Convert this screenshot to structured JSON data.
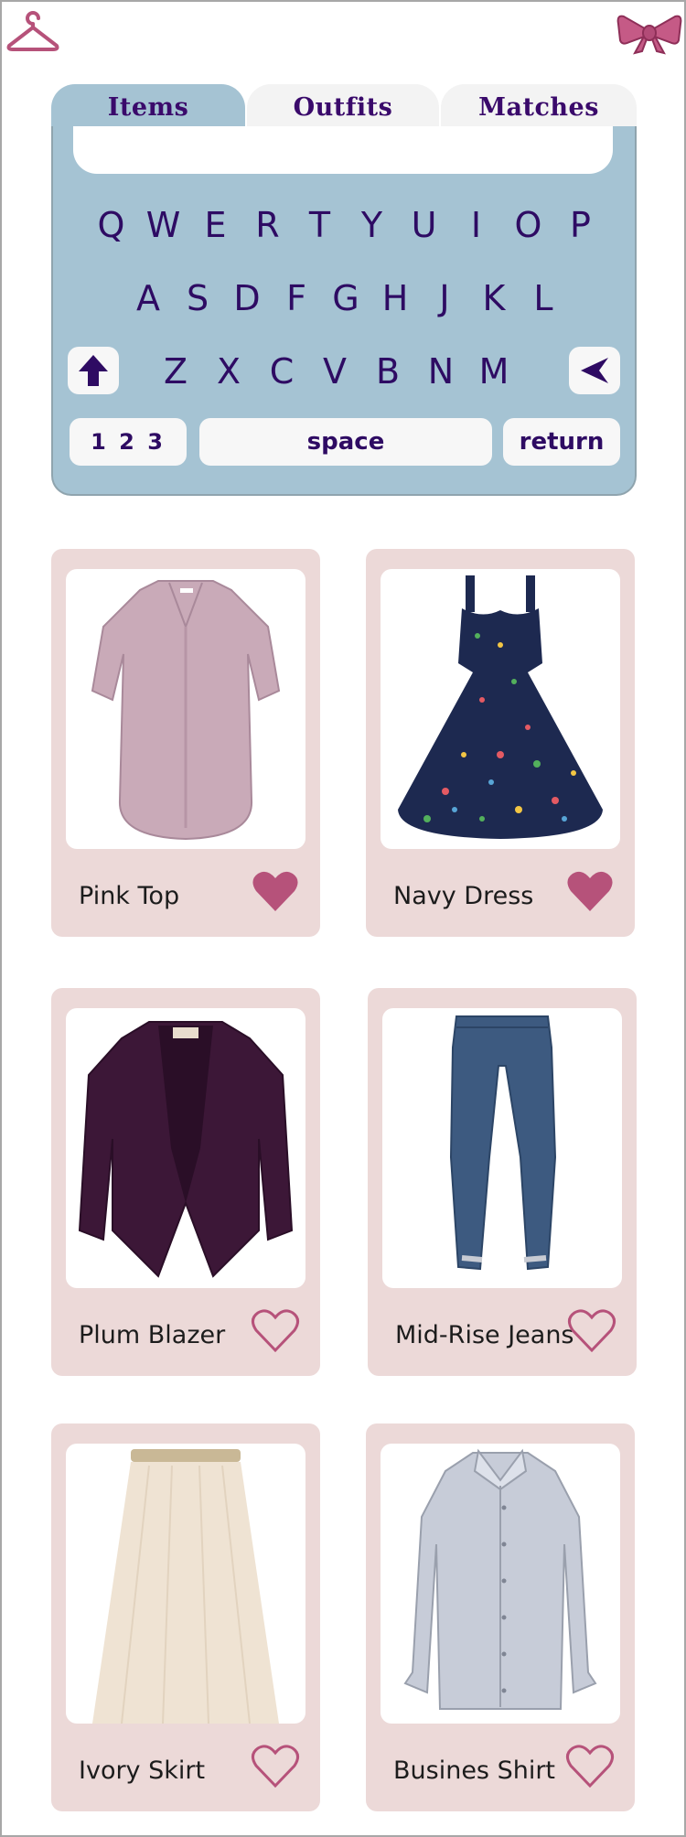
{
  "header": {
    "left_icon": "hanger-icon",
    "right_icon": "bow-icon",
    "accent_color": "#b6527a"
  },
  "tabs": [
    {
      "label": "Items",
      "selected": true
    },
    {
      "label": "Outfits",
      "selected": false
    },
    {
      "label": "Matches",
      "selected": false
    }
  ],
  "search": {
    "value": "",
    "placeholder": ""
  },
  "keyboard": {
    "row1": [
      "Q",
      "W",
      "E",
      "R",
      "T",
      "Y",
      "U",
      "I",
      "O",
      "P"
    ],
    "row2": [
      "A",
      "S",
      "D",
      "F",
      "G",
      "H",
      "J",
      "K",
      "L"
    ],
    "row3": [
      "Z",
      "X",
      "C",
      "V",
      "B",
      "N",
      "M"
    ],
    "numbers_label": "1 2 3",
    "space_label": "space",
    "return_label": "return",
    "shift_icon": "shift-arrow-icon",
    "backspace_icon": "backspace-icon"
  },
  "items": [
    {
      "name": "Pink Top",
      "favorite": true,
      "image": "pink-top-image"
    },
    {
      "name": "Navy Dress",
      "favorite": true,
      "image": "navy-dress-image"
    },
    {
      "name": "Plum Blazer",
      "favorite": false,
      "image": "plum-blazer-image"
    },
    {
      "name": "Mid-Rise Jeans",
      "favorite": false,
      "image": "jeans-image"
    },
    {
      "name": "Ivory Skirt",
      "favorite": false,
      "image": "ivory-skirt-image"
    },
    {
      "name": "Busines Shirt",
      "favorite": false,
      "image": "business-shirt-image"
    }
  ],
  "colors": {
    "tab_active": "#a5c3d3",
    "tab_inactive": "#f3f3f3",
    "key_text": "#2e0b63",
    "card_bg": "#ecd9d8",
    "heart": "#b6527a"
  }
}
